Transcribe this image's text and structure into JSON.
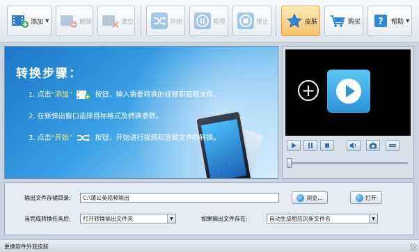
{
  "toolbar": {
    "add": "添加",
    "delete": "删除",
    "clear": "清空",
    "start": "开始",
    "pause": "暂停",
    "stop": "停止",
    "skin": "皮肤",
    "buy": "购买",
    "help": "帮助"
  },
  "banner": {
    "title": "转换步骤：",
    "step1_prefix": "1. 点击",
    "step1_quote": "“添加”",
    "step1_suffix": "按钮，输入需要转换的视频和音频文件。",
    "step2": "2. 在新弹出窗口选择目标格式及转换参数。",
    "step3_prefix": "3. 点击",
    "step3_quote": "“开始”",
    "step3_suffix": "按钮，开始进行视频和音频文件的转换。"
  },
  "settings": {
    "output_dir_label": "输出文件存储目录:",
    "output_dir_value": "C:\\蒲公英视频输出",
    "browse": "浏览...",
    "open": "打开",
    "after_done_label": "当完成转换任务后:",
    "after_done_value": "打开转换输出文件夹",
    "exists_label": "如果输出文件存在:",
    "exists_value": "自动生成相应的新文件名"
  },
  "status": {
    "text": "更换软件外观皮肤"
  },
  "colors": {
    "accent": "#2c93d6",
    "skin_button": "#f6c46a"
  }
}
